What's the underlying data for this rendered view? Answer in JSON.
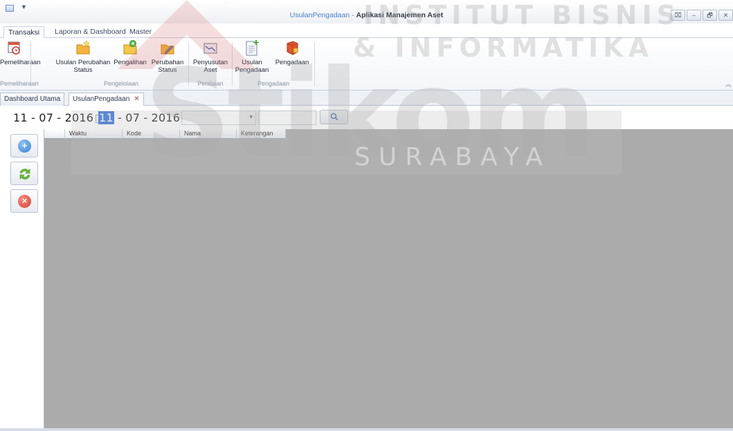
{
  "window": {
    "title_doc": "UsulanPengadaan - ",
    "title_app": "Aplikasi Manajemen Aset",
    "controls": [
      "⌧",
      "–",
      "🗗",
      "✕"
    ]
  },
  "ribbon_tabs": [
    "Transaksi",
    "Laporan & Dashboard",
    "Master"
  ],
  "ribbon": {
    "buttons": [
      {
        "l1": "Pemeliharaan",
        "l2": "",
        "icon": "calendar-icon"
      },
      {
        "l1": "Usulan Perubahan",
        "l2": "Status",
        "icon": "folder-star-icon"
      },
      {
        "l1": "Pengalihan",
        "l2": "",
        "icon": "folder-transfer-icon"
      },
      {
        "l1": "Perubahan",
        "l2": "Status",
        "icon": "folder-edit-icon"
      },
      {
        "l1": "Penyusutan",
        "l2": "Aset",
        "icon": "chart-icon"
      },
      {
        "l1": "Usulan",
        "l2": "Pengadaan",
        "icon": "document-add-icon"
      },
      {
        "l1": "Pengadaan",
        "l2": "",
        "icon": "box-icon"
      }
    ],
    "groups": [
      "Pemeliharaan",
      "Pengelolaan",
      "Penilaian",
      "Pengadaan"
    ]
  },
  "doc_tabs": [
    "Dashboard Utama",
    "UsulanPengadaan"
  ],
  "filters": {
    "date_from": {
      "day": "11",
      "rest": " - 07 - 2016"
    },
    "date_to": {
      "day": "11",
      "rest": " - 07 - 2016"
    }
  },
  "grid": {
    "columns": [
      "Waktu",
      "Kode",
      "Nama",
      "Keterangan"
    ]
  },
  "watermark": {
    "line1": "INSTITUT BISNIS",
    "line2": "& INFORMATIKA",
    "big": "Stikom",
    "line3": "SURABAYA"
  },
  "colors": {
    "accent": "#3a74d8",
    "grid_bg": "#ababab",
    "add": "#3d83d6",
    "refresh": "#5aa83a",
    "delete": "#d9443a"
  }
}
